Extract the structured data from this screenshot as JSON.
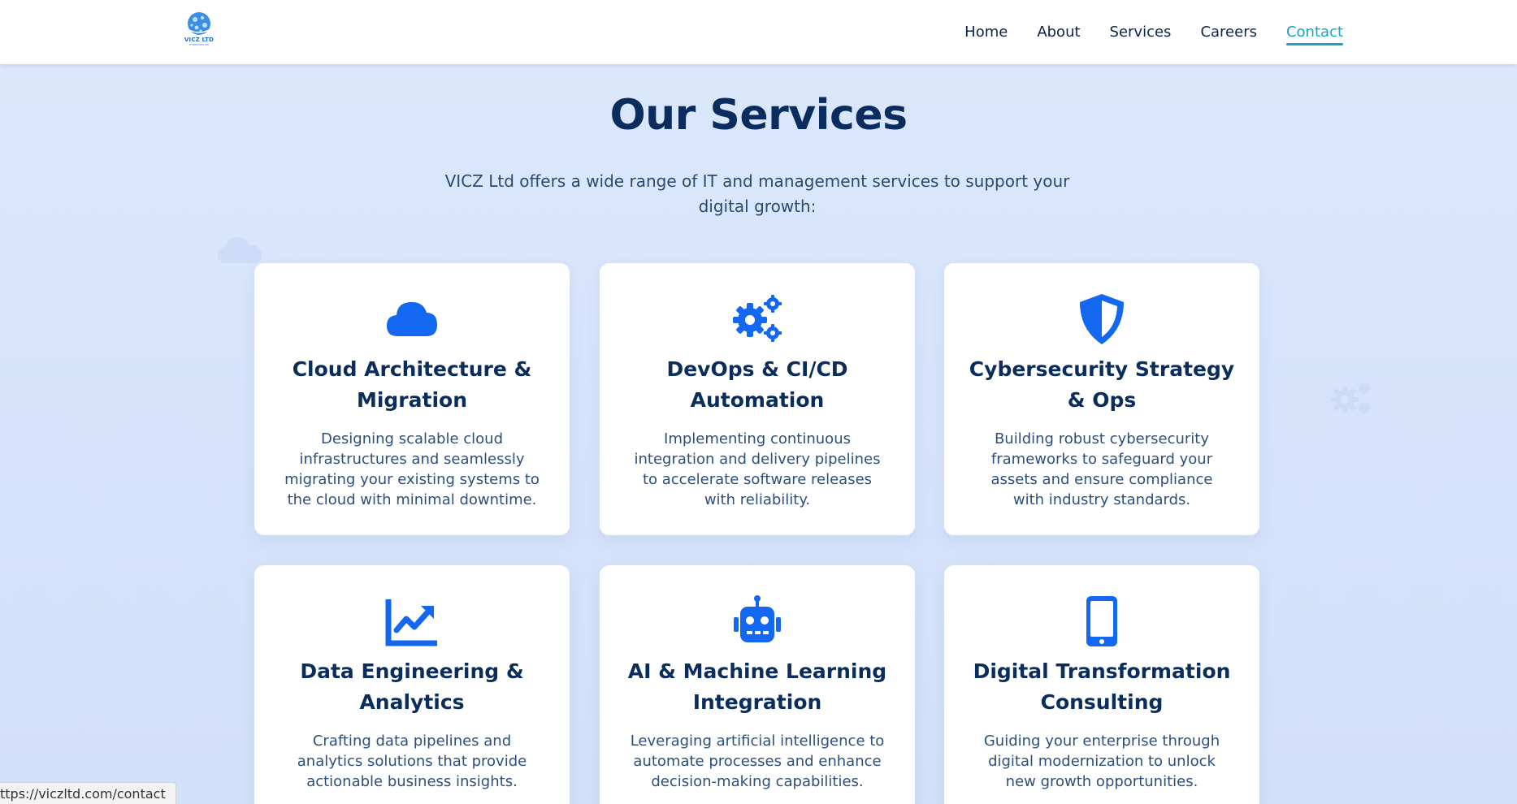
{
  "brand": {
    "logo_text": "VICZ LTD",
    "logo_subtext": "IT SERVICES LTD",
    "color": "#1e6fd0"
  },
  "nav": {
    "items": [
      {
        "label": "Home",
        "active": false
      },
      {
        "label": "About",
        "active": false
      },
      {
        "label": "Services",
        "active": false
      },
      {
        "label": "Careers",
        "active": false
      },
      {
        "label": "Contact",
        "active": true
      }
    ],
    "active_color": "#17a2c8"
  },
  "hero": {
    "title": "Our Services",
    "subtitle": "VICZ Ltd offers a wide range of IT and management services to support your digital growth:"
  },
  "services": [
    {
      "icon": "cloud-icon",
      "title": "Cloud Architecture & Migration",
      "description": "Designing scalable cloud infrastructures and seamlessly migrating your existing systems to the cloud with minimal downtime."
    },
    {
      "icon": "gears-icon",
      "title": "DevOps & CI/CD Automation",
      "description": "Implementing continuous integration and delivery pipelines to accelerate software releases with reliability."
    },
    {
      "icon": "shield-icon",
      "title": "Cybersecurity Strategy & Ops",
      "description": "Building robust cybersecurity frameworks to safeguard your assets and ensure compliance with industry standards."
    },
    {
      "icon": "chart-line-icon",
      "title": "Data Engineering & Analytics",
      "description": "Crafting data pipelines and analytics solutions that provide actionable business insights."
    },
    {
      "icon": "robot-icon",
      "title": "AI & Machine Learning Integration",
      "description": "Leveraging artificial intelligence to automate processes and enhance decision-making capabilities."
    },
    {
      "icon": "mobile-icon",
      "title": "Digital Transformation Consulting",
      "description": "Guiding your enterprise through digital modernization to unlock new growth opportunities."
    }
  ],
  "colors": {
    "icon_blue": "#1467f0",
    "heading_navy": "#0b2d5c",
    "background": "#d9e5fb"
  },
  "status_bar": {
    "url": "ttps://viczltd.com/contact"
  }
}
